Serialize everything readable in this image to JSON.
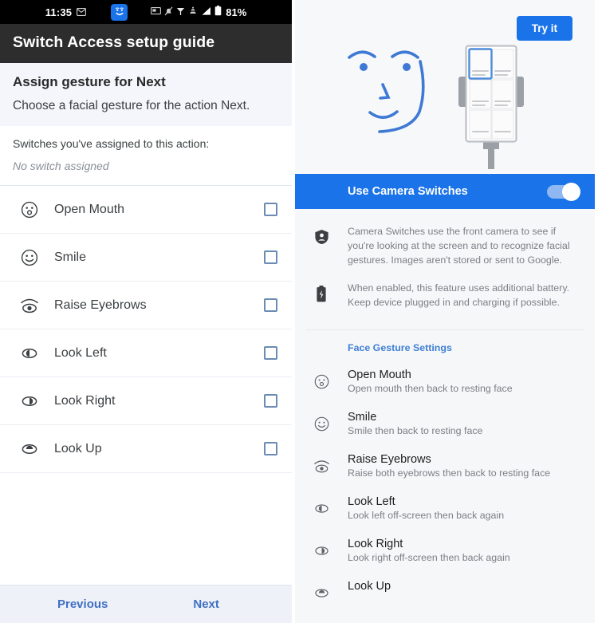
{
  "left": {
    "statusbar": {
      "time": "11:35",
      "battery_percent": "81%",
      "icons": [
        "envelope-icon",
        "camera-switches-face-icon",
        "screenshot-icon",
        "notifications-muted-icon",
        "location-icon",
        "vpn-icon",
        "signal-icon",
        "battery-icon"
      ]
    },
    "title": "Switch Access setup guide",
    "assign": {
      "heading": "Assign gesture for Next",
      "subtext": "Choose a facial gesture for the action Next."
    },
    "assigned": {
      "label": "Switches you've assigned to this action:",
      "value": "No switch assigned"
    },
    "gestures": [
      {
        "label": "Open Mouth",
        "icon": "open-mouth-face-icon",
        "checked": false
      },
      {
        "label": "Smile",
        "icon": "smile-face-icon",
        "checked": false
      },
      {
        "label": "Raise Eyebrows",
        "icon": "raise-eyebrows-icon",
        "checked": false
      },
      {
        "label": "Look Left",
        "icon": "look-left-eye-icon",
        "checked": false
      },
      {
        "label": "Look Right",
        "icon": "look-right-eye-icon",
        "checked": false
      },
      {
        "label": "Look Up",
        "icon": "look-up-eye-icon",
        "checked": false
      }
    ],
    "nav": {
      "previous": "Previous",
      "next": "Next"
    }
  },
  "right": {
    "try_it": "Try it",
    "illustration": {
      "face": "line-art-face-illustration",
      "phone": "phone-on-stand-illustration",
      "highlighted_card": "top-left"
    },
    "toggle": {
      "label": "Use Camera Switches",
      "state": "on"
    },
    "info": [
      {
        "icon": "privacy-face-shield-icon",
        "text": "Camera Switches use the front camera to see if you're looking at the screen and to recognize facial gestures. Images aren't stored or sent to Google."
      },
      {
        "icon": "battery-charging-icon",
        "text": "When enabled, this feature uses additional battery. Keep device plugged in and charging if possible."
      }
    ],
    "section_header": "Face Gesture Settings",
    "settings": [
      {
        "title": "Open Mouth",
        "desc": "Open mouth then back to resting face",
        "icon": "open-mouth-face-icon"
      },
      {
        "title": "Smile",
        "desc": "Smile then back to resting face",
        "icon": "smile-face-icon"
      },
      {
        "title": "Raise Eyebrows",
        "desc": "Raise both eyebrows then back to resting face",
        "icon": "raise-eyebrows-icon"
      },
      {
        "title": "Look Left",
        "desc": "Look left off-screen then back again",
        "icon": "look-left-eye-icon"
      },
      {
        "title": "Look Right",
        "desc": "Look right off-screen then back again",
        "icon": "look-right-eye-icon"
      },
      {
        "title": "Look Up",
        "desc": "",
        "icon": "look-up-eye-icon"
      }
    ]
  },
  "colors": {
    "accent_blue": "#1a73e8",
    "section_blue": "#3f7fd6",
    "nav_blue": "#3f6fc4",
    "statusbar_black": "#000000",
    "titlebar_dark": "#2d2d2d",
    "left_bg": "#eef1f8",
    "right_bg": "#f6f7f8",
    "checkbox_border": "#6b8bb5"
  }
}
